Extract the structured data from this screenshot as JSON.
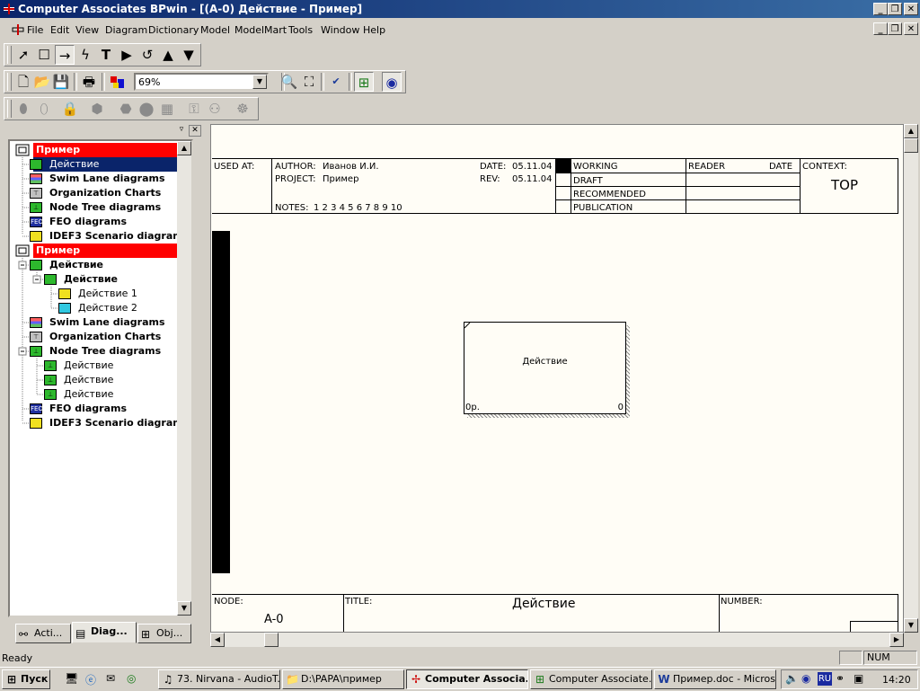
{
  "window": {
    "title": "Computer Associates BPwin - [(A-0) Действие - Пример]",
    "caption_buttons": [
      "_",
      "❐",
      "✕"
    ]
  },
  "menu": [
    "File",
    "Edit",
    "View",
    "Diagram",
    "Dictionary",
    "Model",
    "ModelMart",
    "Tools",
    "Window",
    "Help"
  ],
  "toolbar": {
    "zoom_value": "69%"
  },
  "tree": {
    "items": [
      {
        "label": "Пример",
        "style": "red"
      },
      {
        "label": "Действие",
        "style": "sel"
      },
      {
        "label": "Swim Lane diagrams"
      },
      {
        "label": "Organization Charts"
      },
      {
        "label": "Node Tree diagrams"
      },
      {
        "label": "FEO diagrams"
      },
      {
        "label": "IDEF3 Scenario diagrams"
      },
      {
        "label": "Пример",
        "style": "red"
      },
      {
        "label": "Действие"
      },
      {
        "label": "Действие"
      },
      {
        "label": "Действие 1"
      },
      {
        "label": "Действие 2"
      },
      {
        "label": "Swim Lane diagrams"
      },
      {
        "label": "Organization Charts"
      },
      {
        "label": "Node Tree diagrams"
      },
      {
        "label": "Действие"
      },
      {
        "label": "Действие"
      },
      {
        "label": "Действие"
      },
      {
        "label": "FEO diagrams"
      },
      {
        "label": "IDEF3 Scenario diagrams"
      }
    ]
  },
  "tabs": [
    "Acti...",
    "Diag...",
    "Obj..."
  ],
  "frame": {
    "used_at": "USED AT:",
    "author_label": "AUTHOR:",
    "author": "Иванов И.И.",
    "project_label": "PROJECT:",
    "project": "Пример",
    "date_label": "DATE:",
    "date": "05.11.04",
    "rev_label": "REV:",
    "rev": "05.11.04",
    "notes_label": "NOTES:",
    "notes": "1 2 3 4 5 6 7 8 9 10",
    "status_options": [
      "WORKING",
      "DRAFT",
      "RECOMMENDED",
      "PUBLICATION"
    ],
    "reader_label": "READER",
    "reader_date_label": "DATE",
    "context_label": "CONTEXT:",
    "context_value": "TOP",
    "node_label": "NODE:",
    "node_value": "A-0",
    "title_label": "TITLE:",
    "title_value": "Действие",
    "number_label": "NUMBER:"
  },
  "activity_box": {
    "name": "Действие",
    "cost": "0р.",
    "number": "0"
  },
  "status": {
    "left": "Ready",
    "num": "NUM"
  },
  "taskbar": {
    "start": "Пуск",
    "buttons": [
      "73. Nirvana - AudioT...",
      "D:\\PAPA\\пример",
      "Computer Associa...",
      "Computer Associate...",
      "Пример.doc - Micros..."
    ],
    "lang": "RU",
    "clock": "14:20"
  }
}
